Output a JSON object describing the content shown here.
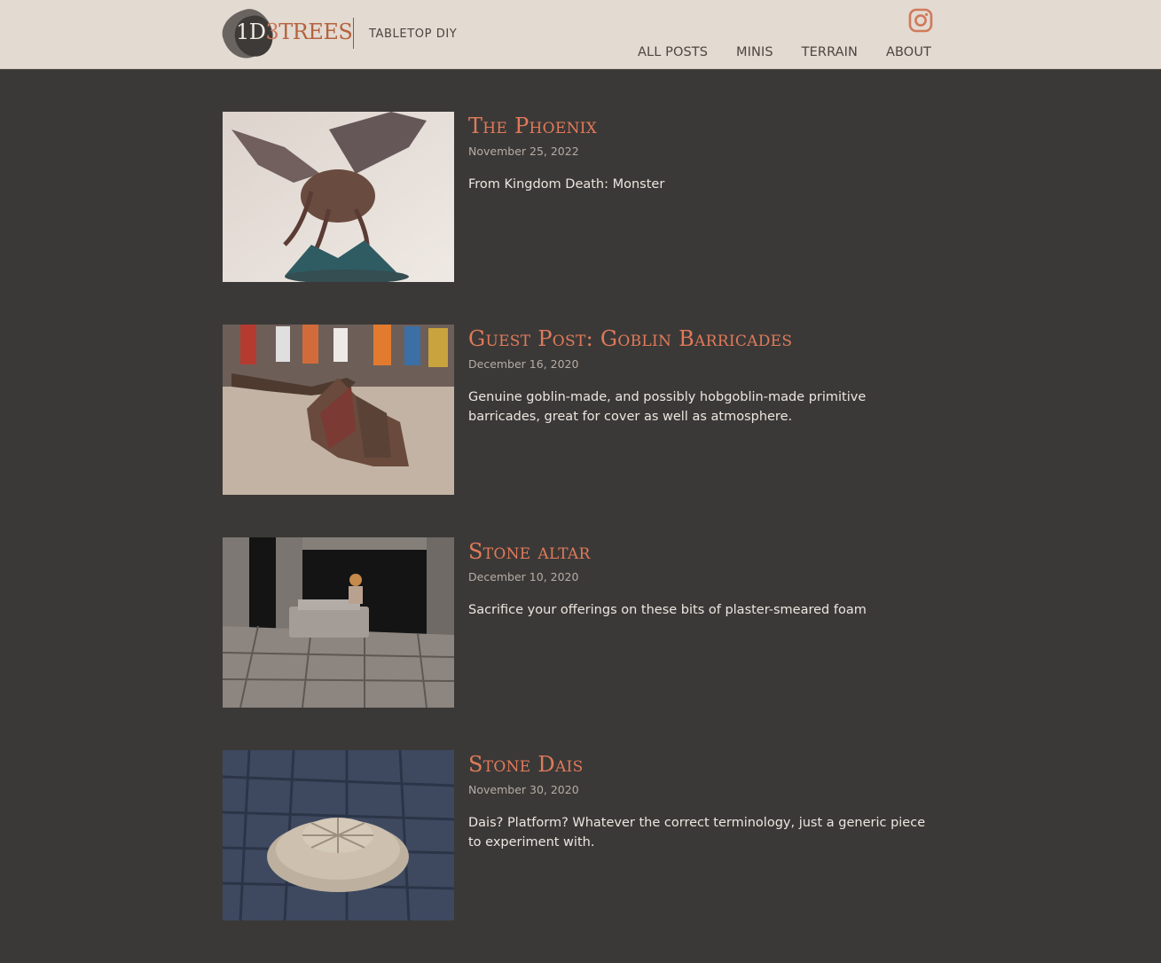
{
  "site": {
    "logo_text_a": "1D",
    "logo_text_b": "3",
    "logo_text_c": "TREES",
    "tagline": "TABLETOP DIY",
    "social_icon": "instagram-icon"
  },
  "nav": {
    "items": [
      {
        "label": "ALL POSTS"
      },
      {
        "label": "MINIS"
      },
      {
        "label": "TERRAIN"
      },
      {
        "label": "ABOUT"
      }
    ]
  },
  "colors": {
    "header_bg": "#e3dad2",
    "page_bg": "#3b3937",
    "accent": "#e07a5a",
    "text": "#ece6e0",
    "date": "#b5aca5"
  },
  "posts": [
    {
      "title": "The Phoenix",
      "date": "November 25, 2022",
      "excerpt": "From Kingdom Death: Monster"
    },
    {
      "title": "Guest Post: Goblin Barricades",
      "date": "December 16, 2020",
      "excerpt": "Genuine goblin-made, and possibly hobgoblin-made primitive barricades, great for cover as well as atmosphere."
    },
    {
      "title": "Stone altar",
      "date": "December 10, 2020",
      "excerpt": "Sacrifice your offerings on these bits of plaster-smeared foam"
    },
    {
      "title": "Stone Dais",
      "date": "November 30, 2020",
      "excerpt": "Dais? Platform? Whatever the correct terminology, just a generic piece to experiment with."
    }
  ]
}
